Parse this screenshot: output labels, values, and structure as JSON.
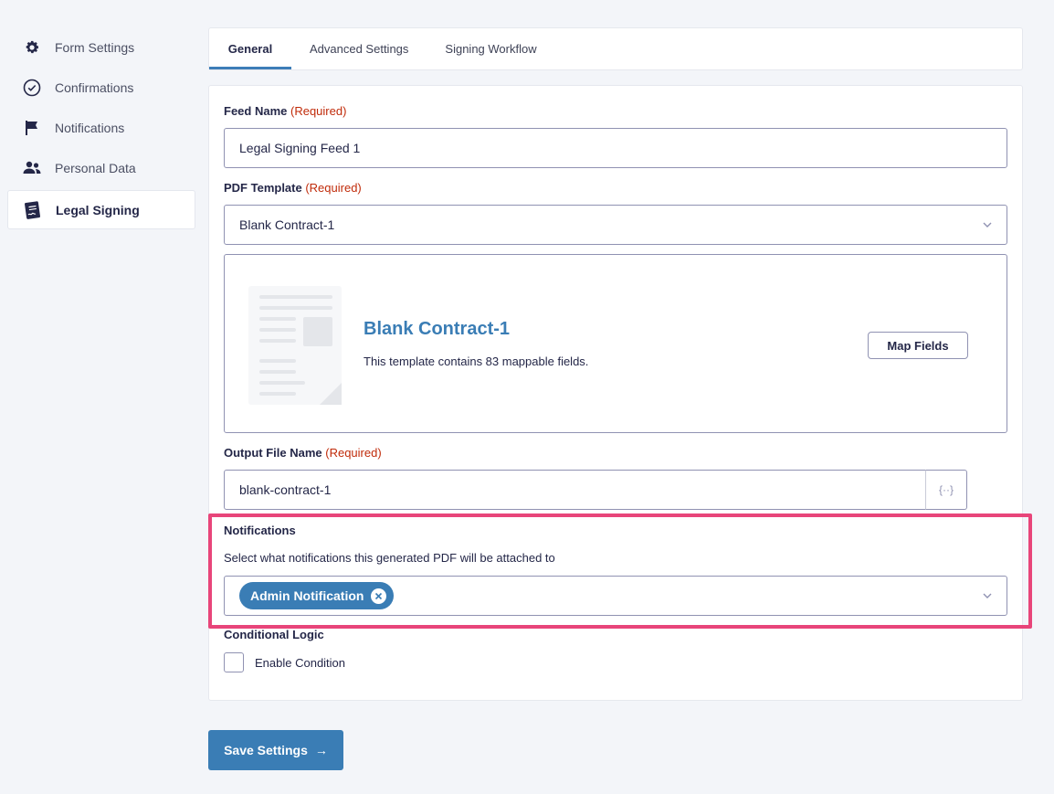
{
  "sidebar": {
    "items": [
      {
        "label": "Form Settings",
        "icon": "gear-icon"
      },
      {
        "label": "Confirmations",
        "icon": "check-circle-icon"
      },
      {
        "label": "Notifications",
        "icon": "flag-icon"
      },
      {
        "label": "Personal Data",
        "icon": "users-icon"
      },
      {
        "label": "Legal Signing",
        "icon": "signed-document-icon",
        "active": true
      }
    ]
  },
  "tabs": [
    {
      "label": "General",
      "active": true
    },
    {
      "label": "Advanced Settings"
    },
    {
      "label": "Signing Workflow"
    }
  ],
  "form": {
    "required_text": "(Required)",
    "feed_name": {
      "label": "Feed Name",
      "value": "Legal Signing Feed 1"
    },
    "pdf_template": {
      "label": "PDF Template",
      "value": "Blank Contract-1"
    },
    "template_preview": {
      "title": "Blank Contract-1",
      "description": "This template contains 83 mappable fields.",
      "map_fields_label": "Map Fields"
    },
    "output_file": {
      "label": "Output File Name",
      "value": "blank-contract-1",
      "merge_tag_symbol": "{··}"
    },
    "notifications": {
      "label": "Notifications",
      "help": "Select what notifications this generated PDF will be attached to",
      "selected": [
        "Admin Notification"
      ]
    },
    "conditional_logic": {
      "label": "Conditional Logic",
      "checkbox_label": "Enable Condition",
      "checked": false
    }
  },
  "save_button": {
    "label": "Save Settings",
    "arrow": "→"
  },
  "colors": {
    "accent": "#3a7db5",
    "required": "#c02b0a",
    "highlight": "#e8457a"
  }
}
